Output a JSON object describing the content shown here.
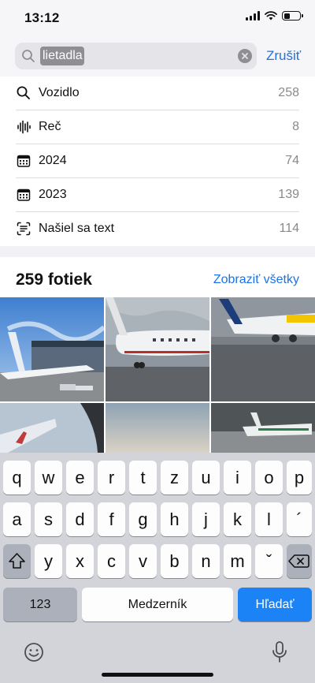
{
  "status_bar": {
    "time": "13:12"
  },
  "search": {
    "token": "lietadla",
    "cancel_label": "Zrušiť"
  },
  "suggestions": [
    {
      "icon": "search-icon",
      "label": "Vozidlo",
      "count": "258"
    },
    {
      "icon": "waveform-icon",
      "label": "Reč",
      "count": "8"
    },
    {
      "icon": "calendar-icon",
      "label": "2024",
      "count": "74"
    },
    {
      "icon": "calendar-icon",
      "label": "2023",
      "count": "139"
    },
    {
      "icon": "text-scan-icon",
      "label": "Našiel sa text",
      "count": "114"
    }
  ],
  "photos": {
    "title": "259 fotiek",
    "see_all": "Zobraziť všetky"
  },
  "keyboard": {
    "row1": [
      "q",
      "w",
      "e",
      "r",
      "t",
      "z",
      "u",
      "i",
      "o",
      "p"
    ],
    "row2": [
      "a",
      "s",
      "d",
      "f",
      "g",
      "h",
      "j",
      "k",
      "l",
      "´"
    ],
    "row3": [
      "y",
      "x",
      "c",
      "v",
      "b",
      "n",
      "m",
      "ˇ"
    ],
    "numbers_label": "123",
    "space_label": "Medzerník",
    "return_label": "Hľadať",
    "shift_icon": "shift-icon",
    "backspace_icon": "backspace-icon",
    "emoji_icon": "emoji-icon",
    "dictation_icon": "microphone-icon"
  },
  "colors": {
    "accent": "#1a73e8",
    "return_key": "#1c83f7",
    "keyboard_bg": "#d2d4da"
  }
}
